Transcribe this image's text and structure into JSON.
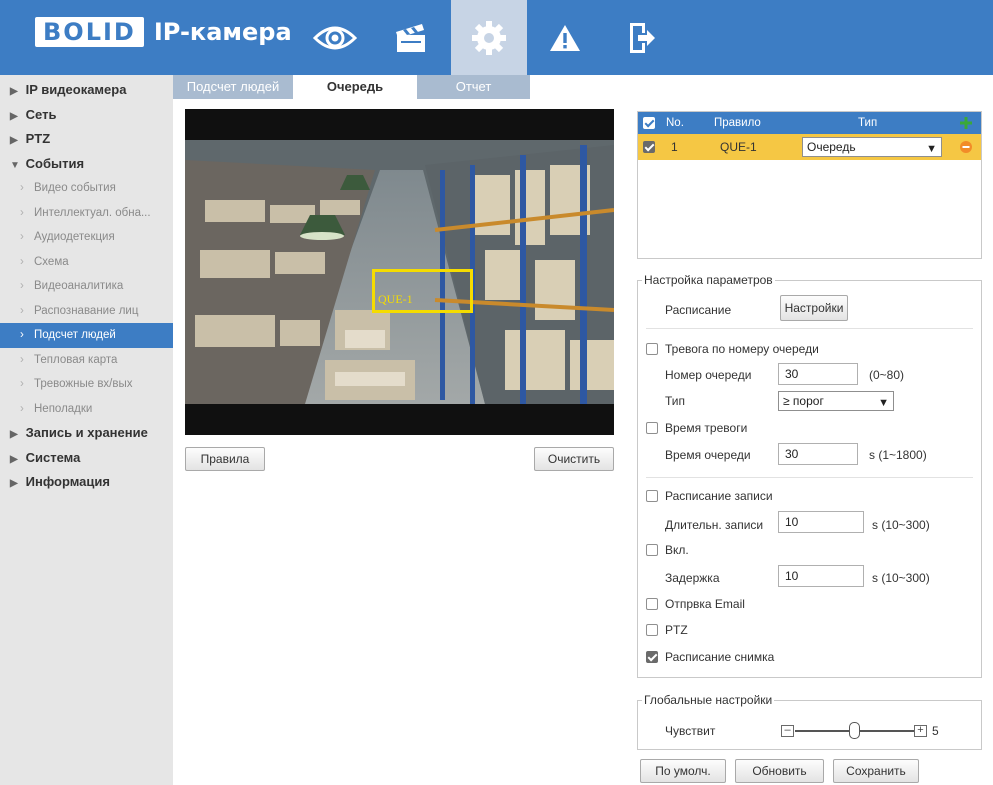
{
  "header": {
    "logo_brand": "BOLID",
    "logo_text": "IP-камера",
    "nav": [
      {
        "icon": "eye-icon",
        "label": "live"
      },
      {
        "icon": "clapperboard-icon",
        "label": "playback"
      },
      {
        "icon": "gear-icon",
        "label": "setup"
      },
      {
        "icon": "warning-icon",
        "label": "alarm"
      },
      {
        "icon": "logout-icon",
        "label": "logout"
      }
    ]
  },
  "sidebar": {
    "items": [
      {
        "label": "IP видеокамера",
        "level": "top"
      },
      {
        "label": "Сеть",
        "level": "top"
      },
      {
        "label": "PTZ",
        "level": "top"
      },
      {
        "label": "События",
        "level": "top",
        "expanded": true
      },
      {
        "label": "Видео события",
        "level": "sub"
      },
      {
        "label": "Интеллектуал. обна...",
        "level": "sub"
      },
      {
        "label": "Аудиодетекция",
        "level": "sub"
      },
      {
        "label": "Схема",
        "level": "sub"
      },
      {
        "label": "Видеоаналитика",
        "level": "sub"
      },
      {
        "label": "Распознавание лиц",
        "level": "sub"
      },
      {
        "label": "Подсчет людей",
        "level": "sub",
        "active": true
      },
      {
        "label": "Тепловая карта",
        "level": "sub"
      },
      {
        "label": "Тревожные вх/вых",
        "level": "sub"
      },
      {
        "label": "Неполадки",
        "level": "sub"
      },
      {
        "label": "Запись и хранение",
        "level": "top"
      },
      {
        "label": "Система",
        "level": "top"
      },
      {
        "label": "Информация",
        "level": "top"
      }
    ]
  },
  "tabs": [
    {
      "label": "Подсчет людей",
      "active": false
    },
    {
      "label": "Очередь",
      "active": true
    },
    {
      "label": "Отчет",
      "active": false
    }
  ],
  "video": {
    "rule_label": "QUE-1",
    "rules_button": "Правила",
    "clear_button": "Очистить"
  },
  "rules_table": {
    "head": {
      "no": "No.",
      "rule": "Правило",
      "type": "Тип"
    },
    "rows": [
      {
        "checked": true,
        "no": "1",
        "rule": "QUE-1",
        "type": "Очередь"
      }
    ]
  },
  "params": {
    "legend": "Настройка параметров",
    "schedule_label": "Расписание",
    "schedule_button": "Настройки",
    "queue_alarm": {
      "label": "Тревога по номеру очереди",
      "checked": false
    },
    "queue_number": {
      "label": "Номер очереди",
      "value": "30",
      "hint": "(0~80)"
    },
    "type": {
      "label": "Тип",
      "value": "≥ порог"
    },
    "alarm_time": {
      "label": "Время тревоги",
      "checked": false
    },
    "queue_time": {
      "label": "Время очереди",
      "value": "30",
      "hint": "s (1~1800)"
    },
    "record_schedule": {
      "label": "Расписание записи",
      "checked": false
    },
    "record_duration": {
      "label": "Длительн. записи",
      "value": "10",
      "hint": "s (10~300)"
    },
    "enable": {
      "label": "Вкл.",
      "checked": false
    },
    "delay": {
      "label": "Задержка",
      "value": "10",
      "hint": "s (10~300)"
    },
    "email": {
      "label": "Отпрвка Email",
      "checked": false
    },
    "ptz": {
      "label": "PTZ",
      "checked": false
    },
    "snapshot": {
      "label": "Расписание снимка",
      "checked": true
    }
  },
  "global": {
    "legend": "Глобальные настройки",
    "sensitivity_label": "Чувствит",
    "sensitivity_value": "5",
    "sensitivity_level": 0.5
  },
  "actions": {
    "default": "По умолч.",
    "refresh": "Обновить",
    "save": "Сохранить"
  },
  "colors": {
    "header_blue": "#3d7dc4",
    "active_tab": "#c7d4e5",
    "selected_row": "#f5c744",
    "rule_yellow": "#f5dc00"
  }
}
